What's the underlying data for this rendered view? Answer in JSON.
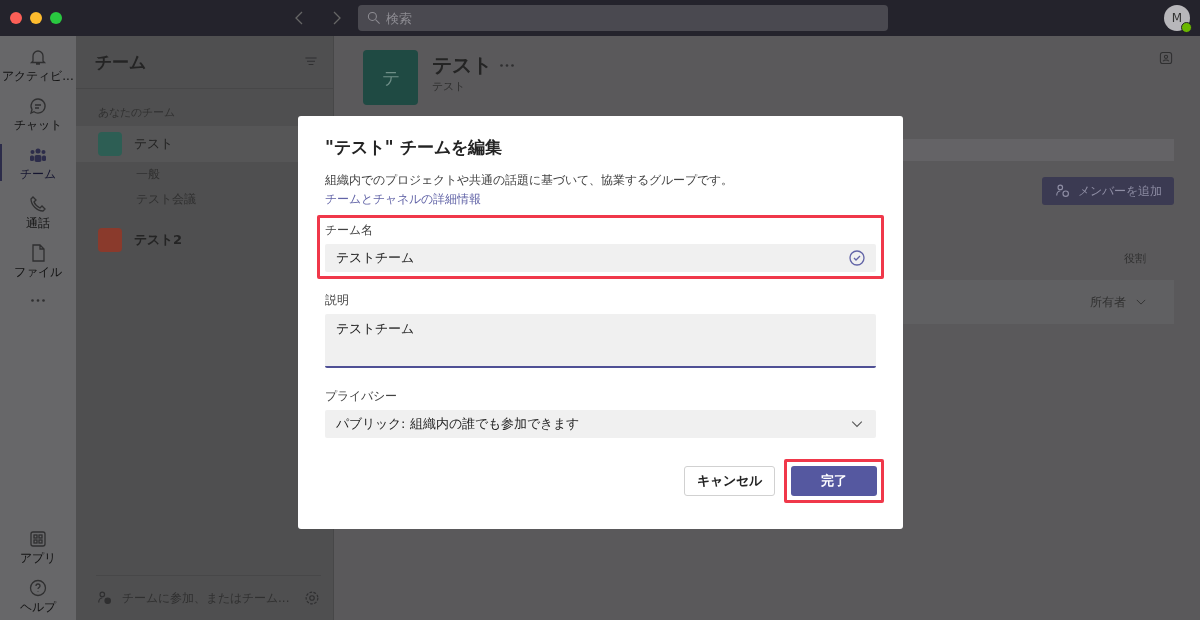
{
  "top_bar": {
    "search": {
      "placeholder": "検索"
    },
    "avatar": {
      "initial": "M"
    }
  },
  "app_bar": {
    "items": [
      {
        "kind": "bell",
        "label": "アクティビ...",
        "selected": false
      },
      {
        "kind": "chat",
        "label": "チャット",
        "selected": false
      },
      {
        "kind": "teams",
        "label": "チーム",
        "selected": true
      },
      {
        "kind": "call",
        "label": "通話",
        "selected": false
      },
      {
        "kind": "file",
        "label": "ファイル",
        "selected": false
      }
    ],
    "bottom_items": [
      {
        "kind": "apps",
        "label": "アプリ"
      },
      {
        "kind": "help",
        "label": "ヘルプ"
      }
    ]
  },
  "sidebar": {
    "title": "チーム",
    "section": "あなたのチーム",
    "teams": [
      {
        "name": "テスト",
        "color": "#2d5e54",
        "selected": true,
        "channels": [
          "一般",
          "テスト会議"
        ]
      },
      {
        "name": "テスト2",
        "color": "#8a3a2c",
        "selected": false
      }
    ],
    "footer": "チームに参加、またはチーム..."
  },
  "team_header": {
    "initial": "テ",
    "title": "テスト",
    "subtitle": "テスト"
  },
  "members": {
    "add_button": "メンバーを追加",
    "columns": [
      "役割"
    ],
    "rows": [
      {
        "role": "所有者"
      }
    ]
  },
  "dialog": {
    "title": "\"テスト\" チームを編集",
    "description": "組織内でのプロジェクトや共通の話題に基づいて、協業するグループです。",
    "link": "チームとチャネルの詳細情報",
    "fields": [
      {
        "kind": "text",
        "label": "チーム名",
        "value": "テストチーム",
        "valid": true,
        "highlighted": true
      },
      {
        "kind": "textarea",
        "label": "説明",
        "value": "テストチーム",
        "highlighted": false
      },
      {
        "kind": "select",
        "label": "プライバシー",
        "value": "パブリック: 組織内の誰でも参加できます",
        "highlighted": false
      }
    ],
    "buttons": [
      {
        "kind": "secondary",
        "label": "キャンセル",
        "highlighted": false
      },
      {
        "kind": "primary",
        "label": "完了",
        "highlighted": true
      }
    ]
  }
}
